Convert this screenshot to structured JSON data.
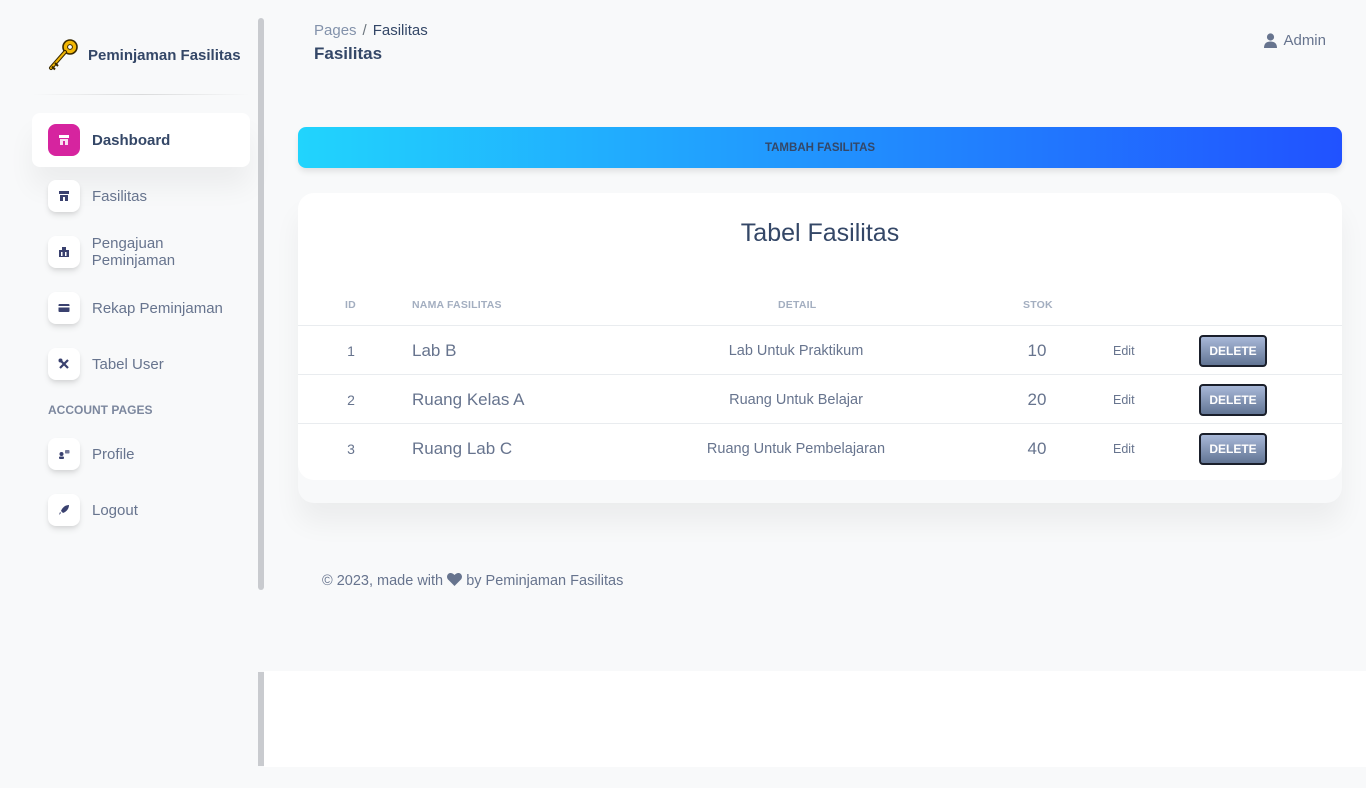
{
  "sidebar": {
    "brand": "Peminjaman Fasilitas",
    "items": [
      {
        "label": "Dashboard",
        "icon": "shop-icon",
        "active": true
      },
      {
        "label": "Fasilitas",
        "icon": "shop-icon",
        "active": false
      },
      {
        "label": "Pengajuan Peminjaman",
        "icon": "office-icon",
        "active": false
      },
      {
        "label": "Rekap Peminjaman",
        "icon": "credit-card-icon",
        "active": false
      },
      {
        "label": "Tabel User",
        "icon": "settings-tools-icon",
        "active": false
      }
    ],
    "section_title": "ACCOUNT PAGES",
    "account_items": [
      {
        "label": "Profile",
        "icon": "customer-support-icon"
      },
      {
        "label": "Logout",
        "icon": "rocket-icon"
      }
    ]
  },
  "header": {
    "breadcrumb_root": "Pages",
    "breadcrumb_sep": "/",
    "breadcrumb_current": "Fasilitas",
    "title": "Fasilitas",
    "user_label": "Admin"
  },
  "main": {
    "add_button": "TAMBAH FASILITAS",
    "table_title": "Tabel Fasilitas",
    "columns": [
      "ID",
      "NAMA FASILITAS",
      "DETAIL",
      "STOK"
    ],
    "rows": [
      {
        "id": "1",
        "name": "Lab B",
        "detail": "Lab Untuk Praktikum",
        "stok": "10",
        "edit": "Edit",
        "delete": "DELETE"
      },
      {
        "id": "2",
        "name": "Ruang Kelas A",
        "detail": "Ruang Untuk Belajar",
        "stok": "20",
        "edit": "Edit",
        "delete": "DELETE"
      },
      {
        "id": "3",
        "name": "Ruang Lab C",
        "detail": "Ruang Untuk Pembelajaran",
        "stok": "40",
        "edit": "Edit",
        "delete": "DELETE"
      }
    ]
  },
  "footer": {
    "prefix": "© 2023, made with",
    "suffix": "by Peminjaman Fasilitas"
  },
  "colors": {
    "accent_active": "#d6249f",
    "gradient_start": "#21d4fd",
    "gradient_end": "#2152ff",
    "text_dark": "#344767",
    "text_muted": "#67748e"
  }
}
